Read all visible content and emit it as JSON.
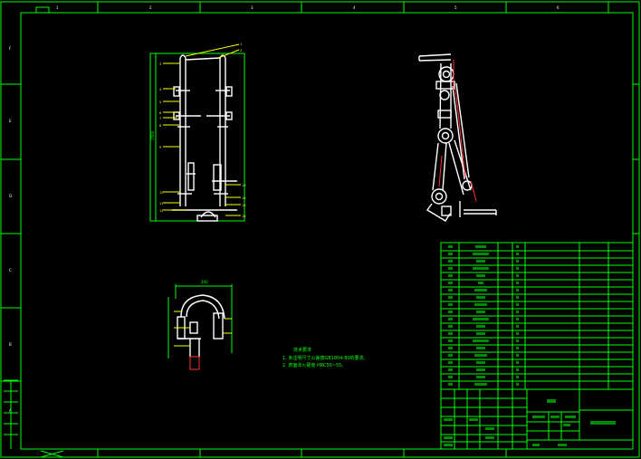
{
  "notes": {
    "title": "技术要求",
    "line1": "1. 未注明尺寸公差按GB1804-80的要求。",
    "line2": "2. 表面淬火硬度 HRC50~55。"
  },
  "dims": {
    "front_height": "1500",
    "side_width": "200"
  }
}
